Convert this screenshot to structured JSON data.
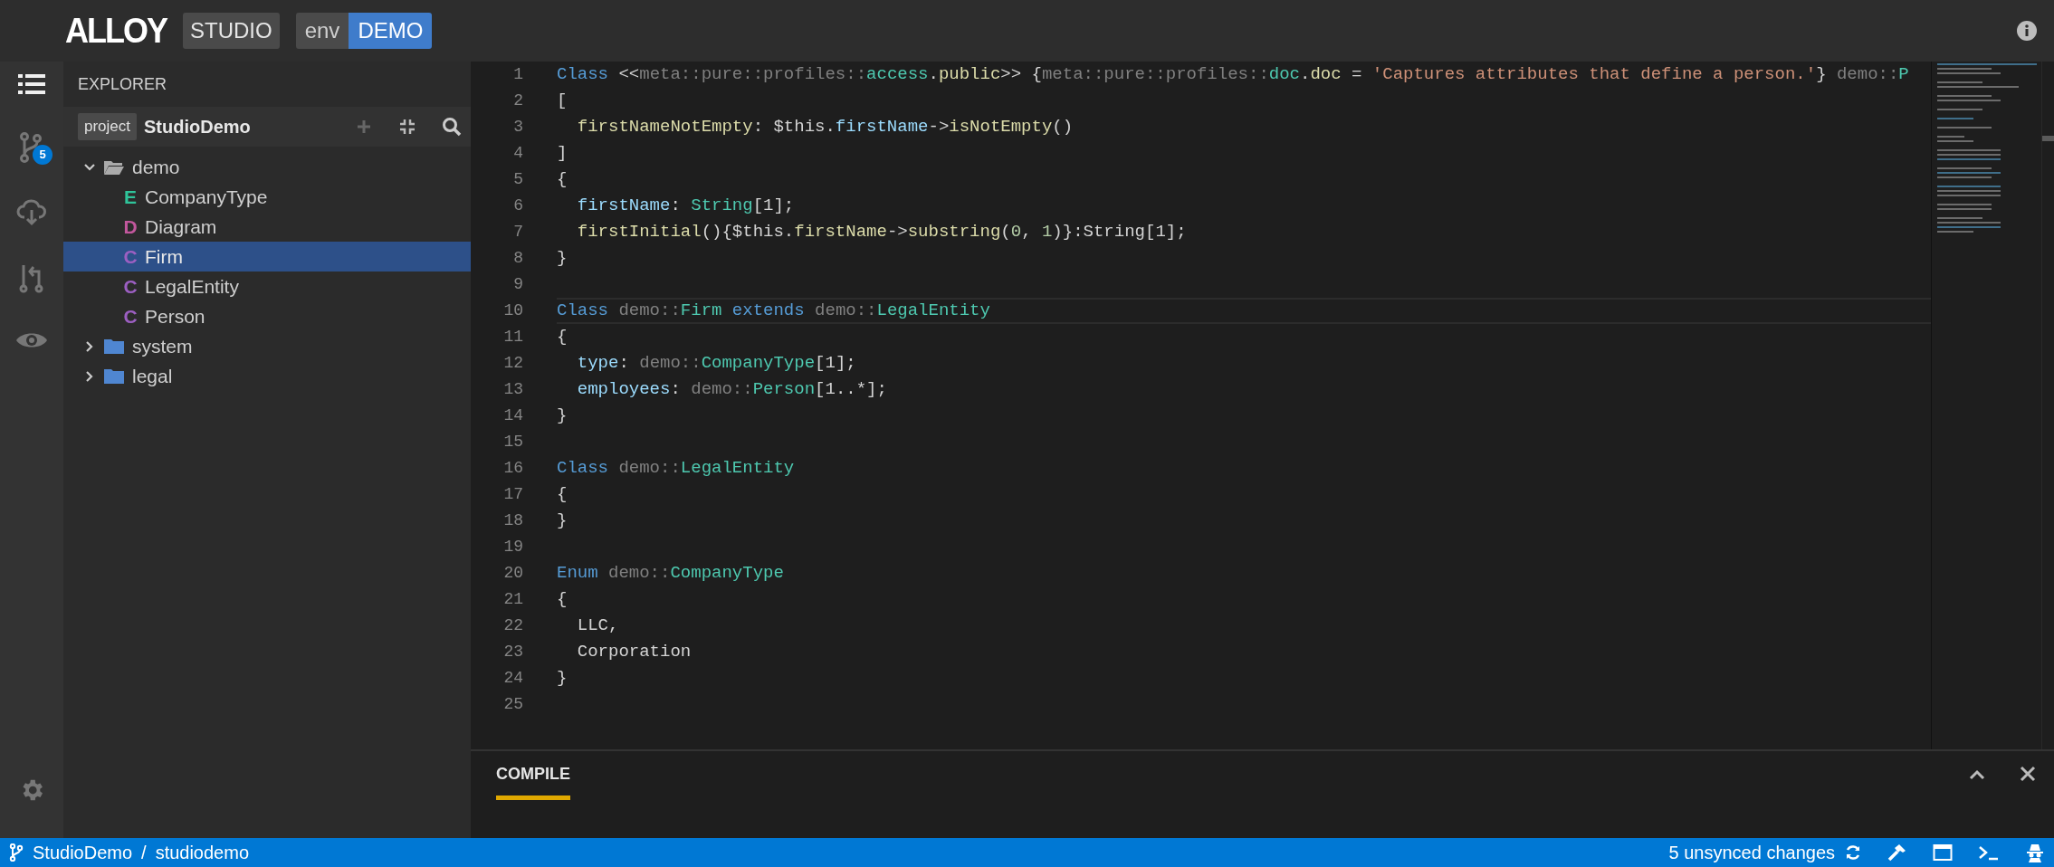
{
  "top_bar": {
    "logo": "ALLOY",
    "app_badge": "STUDIO",
    "env_label": "env",
    "env_value": "DEMO"
  },
  "activity_bar": {
    "items": [
      {
        "kind": "list",
        "selected": true
      },
      {
        "kind": "branch",
        "selected": false,
        "badge": "5"
      },
      {
        "kind": "cloud",
        "selected": false
      },
      {
        "kind": "pull",
        "selected": false
      },
      {
        "kind": "eye",
        "selected": false
      }
    ]
  },
  "explorer": {
    "title": "EXPLORER",
    "project_tag": "project",
    "project_name": "StudioDemo",
    "tree": [
      {
        "kind": "folder",
        "label": "demo",
        "expanded": true,
        "selected": false,
        "children": [
          {
            "kind": "enum",
            "badge": "E",
            "label": "CompanyType",
            "selected": false
          },
          {
            "kind": "diagram",
            "badge": "D",
            "label": "Diagram",
            "selected": false
          },
          {
            "kind": "class",
            "badge": "C",
            "label": "Firm",
            "selected": true
          },
          {
            "kind": "class",
            "badge": "C",
            "label": "LegalEntity",
            "selected": false
          },
          {
            "kind": "class",
            "badge": "C",
            "label": "Person",
            "selected": false
          }
        ]
      },
      {
        "kind": "folder",
        "label": "system",
        "expanded": false,
        "selected": false
      },
      {
        "kind": "folder",
        "label": "legal",
        "expanded": false,
        "selected": false
      }
    ]
  },
  "editor": {
    "lines": [
      {
        "number": "1",
        "current": false,
        "tokens": [
          {
            "text": "Class",
            "kind": "keyword"
          },
          {
            "text": " <<",
            "kind": "plain"
          },
          {
            "text": "meta::pure::profiles::",
            "kind": "path"
          },
          {
            "text": "access",
            "kind": "type"
          },
          {
            "text": ".",
            "kind": "plain"
          },
          {
            "text": "public",
            "kind": "func"
          },
          {
            "text": ">> {",
            "kind": "plain"
          },
          {
            "text": "meta::pure::profiles::",
            "kind": "path"
          },
          {
            "text": "doc",
            "kind": "type"
          },
          {
            "text": ".",
            "kind": "plain"
          },
          {
            "text": "doc",
            "kind": "func"
          },
          {
            "text": " = ",
            "kind": "plain"
          },
          {
            "text": "'Captures attributes that define a person.'",
            "kind": "string"
          },
          {
            "text": "} ",
            "kind": "plain"
          },
          {
            "text": "demo::",
            "kind": "path"
          },
          {
            "text": "P",
            "kind": "type"
          }
        ]
      },
      {
        "number": "2",
        "current": false,
        "tokens": [
          {
            "text": "[",
            "kind": "plain"
          }
        ]
      },
      {
        "number": "3",
        "current": false,
        "tokens": [
          {
            "text": "  firstNameNotEmpty",
            "kind": "func"
          },
          {
            "text": ": $this.",
            "kind": "plain"
          },
          {
            "text": "firstName",
            "kind": "prop"
          },
          {
            "text": "->",
            "kind": "plain"
          },
          {
            "text": "isNotEmpty",
            "kind": "func"
          },
          {
            "text": "()",
            "kind": "plain"
          }
        ]
      },
      {
        "number": "4",
        "current": false,
        "tokens": [
          {
            "text": "]",
            "kind": "plain"
          }
        ]
      },
      {
        "number": "5",
        "current": false,
        "tokens": [
          {
            "text": "{",
            "kind": "plain"
          }
        ]
      },
      {
        "number": "6",
        "current": false,
        "tokens": [
          {
            "text": "  firstName",
            "kind": "prop"
          },
          {
            "text": ": ",
            "kind": "plain"
          },
          {
            "text": "String",
            "kind": "type"
          },
          {
            "text": "[1];",
            "kind": "plain"
          }
        ]
      },
      {
        "number": "7",
        "current": false,
        "tokens": [
          {
            "text": "  firstInitial",
            "kind": "func"
          },
          {
            "text": "(){$this.",
            "kind": "plain"
          },
          {
            "text": "firstName",
            "kind": "func"
          },
          {
            "text": "->",
            "kind": "plain"
          },
          {
            "text": "substring",
            "kind": "func"
          },
          {
            "text": "(",
            "kind": "plain"
          },
          {
            "text": "0",
            "kind": "number"
          },
          {
            "text": ", ",
            "kind": "plain"
          },
          {
            "text": "1",
            "kind": "number"
          },
          {
            "text": ")}:String[1];",
            "kind": "plain"
          }
        ]
      },
      {
        "number": "8",
        "current": false,
        "tokens": [
          {
            "text": "}",
            "kind": "plain"
          }
        ]
      },
      {
        "number": "9",
        "current": false
      },
      {
        "number": "10",
        "current": true,
        "tokens": [
          {
            "text": "Class",
            "kind": "keyword"
          },
          {
            "text": " demo::",
            "kind": "path"
          },
          {
            "text": "Firm",
            "kind": "type"
          },
          {
            "text": " extends",
            "kind": "keyword"
          },
          {
            "text": " demo::",
            "kind": "path"
          },
          {
            "text": "LegalEntity",
            "kind": "type"
          }
        ]
      },
      {
        "number": "11",
        "current": false,
        "tokens": [
          {
            "text": "{",
            "kind": "plain"
          }
        ]
      },
      {
        "number": "12",
        "current": false,
        "tokens": [
          {
            "text": "  type",
            "kind": "prop"
          },
          {
            "text": ": ",
            "kind": "plain"
          },
          {
            "text": "demo::",
            "kind": "path"
          },
          {
            "text": "CompanyType",
            "kind": "type"
          },
          {
            "text": "[1];",
            "kind": "plain"
          }
        ]
      },
      {
        "number": "13",
        "current": false,
        "tokens": [
          {
            "text": "  employees",
            "kind": "prop"
          },
          {
            "text": ": ",
            "kind": "plain"
          },
          {
            "text": "demo::",
            "kind": "path"
          },
          {
            "text": "Person",
            "kind": "type"
          },
          {
            "text": "[1..*];",
            "kind": "plain"
          }
        ]
      },
      {
        "number": "14",
        "current": false,
        "tokens": [
          {
            "text": "}",
            "kind": "plain"
          }
        ]
      },
      {
        "number": "15",
        "current": false
      },
      {
        "number": "16",
        "current": false,
        "tokens": [
          {
            "text": "Class",
            "kind": "keyword"
          },
          {
            "text": " demo::",
            "kind": "path"
          },
          {
            "text": "LegalEntity",
            "kind": "type"
          }
        ]
      },
      {
        "number": "17",
        "current": false,
        "tokens": [
          {
            "text": "{",
            "kind": "plain"
          }
        ]
      },
      {
        "number": "18",
        "current": false,
        "tokens": [
          {
            "text": "}",
            "kind": "plain"
          }
        ]
      },
      {
        "number": "19",
        "current": false
      },
      {
        "number": "20",
        "current": false,
        "tokens": [
          {
            "text": "Enum",
            "kind": "keyword"
          },
          {
            "text": " demo::",
            "kind": "path"
          },
          {
            "text": "CompanyType",
            "kind": "type"
          }
        ]
      },
      {
        "number": "21",
        "current": false,
        "tokens": [
          {
            "text": "{",
            "kind": "plain"
          }
        ]
      },
      {
        "number": "22",
        "current": false,
        "tokens": [
          {
            "text": "  LLC,",
            "kind": "plain"
          }
        ]
      },
      {
        "number": "23",
        "current": false,
        "tokens": [
          {
            "text": "  Corporation",
            "kind": "plain"
          }
        ]
      },
      {
        "number": "24",
        "current": false,
        "tokens": [
          {
            "text": "}",
            "kind": "plain"
          }
        ]
      },
      {
        "number": "25",
        "current": false
      }
    ]
  },
  "panel": {
    "tabs": [
      {
        "label": "COMPILE",
        "selected": true
      }
    ]
  },
  "status_bar": {
    "project": "StudioDemo",
    "separator": "/",
    "workspace": "studiodemo",
    "changes": "5 unsynced changes"
  }
}
